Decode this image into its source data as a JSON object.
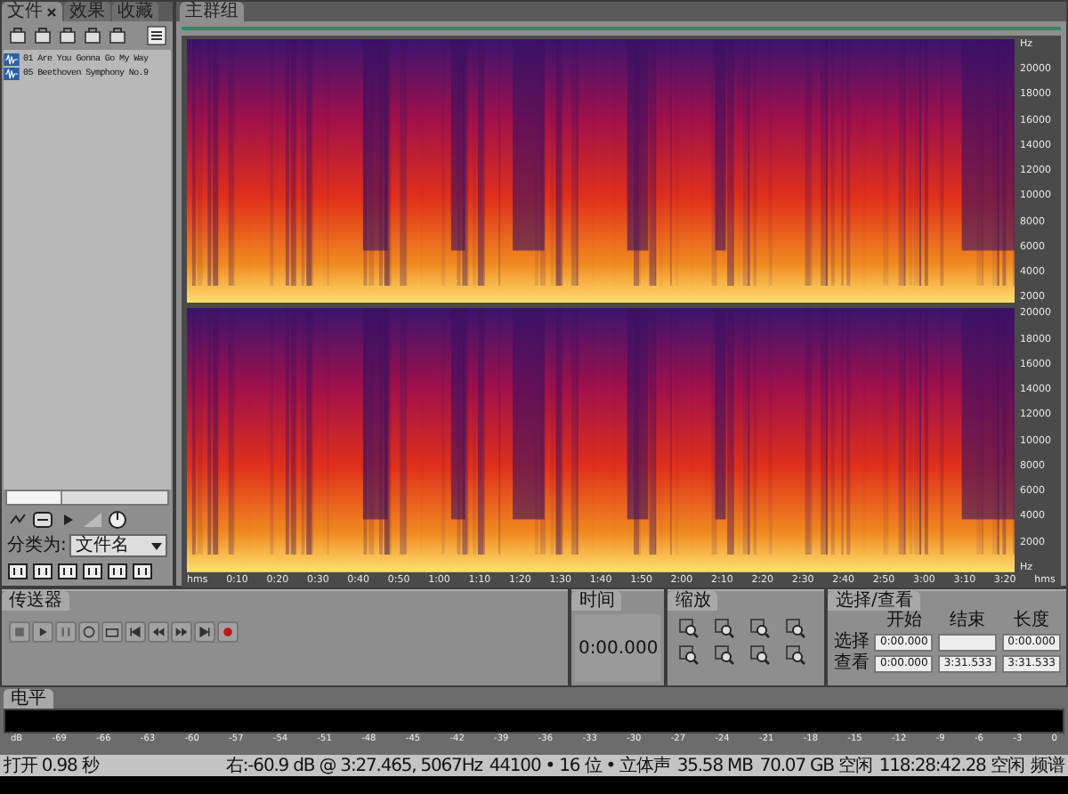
{
  "left_panel": {
    "tabs": [
      {
        "label": "文件",
        "selected": true
      },
      {
        "label": "效果",
        "selected": false
      },
      {
        "label": "收藏",
        "selected": false
      }
    ],
    "files": [
      "01 Are You Gonna Go My Way",
      "05 Beethoven Symphony No.9"
    ],
    "sort_label": "分类为:",
    "sort_value": "文件名"
  },
  "editor": {
    "tab": "主群组",
    "time_ticks": [
      "hms",
      "0:10",
      "0:20",
      "0:30",
      "0:40",
      "0:50",
      "1:00",
      "1:10",
      "1:20",
      "1:30",
      "1:40",
      "1:50",
      "2:00",
      "2:10",
      "2:20",
      "2:30",
      "2:40",
      "2:50",
      "3:00",
      "3:10",
      "3:20",
      "hms"
    ],
    "channels": [
      {
        "freq_ticks": [
          "Hz",
          "20000",
          "18000",
          "16000",
          "14000",
          "12000",
          "10000",
          "8000",
          "6000",
          "4000",
          "2000"
        ]
      },
      {
        "freq_ticks": [
          "20000",
          "18000",
          "16000",
          "14000",
          "12000",
          "10000",
          "8000",
          "6000",
          "4000",
          "2000",
          "Hz"
        ]
      }
    ]
  },
  "transport": {
    "title": "传送器"
  },
  "time_panel": {
    "title": "时间",
    "value": "0:00.000"
  },
  "zoom_panel": {
    "title": "缩放"
  },
  "selection_panel": {
    "title": "选择/查看",
    "columns": [
      "开始",
      "结束",
      "长度"
    ],
    "rows": [
      {
        "label": "选择",
        "start": "0:00.000",
        "length": "0:00.000"
      },
      {
        "label": "查看",
        "start": "0:00.000",
        "end": "3:31.533",
        "length": "3:31.533"
      }
    ]
  },
  "level_meter": {
    "title": "电平",
    "scale": [
      "dB",
      "-69",
      "-66",
      "-63",
      "-60",
      "-57",
      "-54",
      "-51",
      "-48",
      "-45",
      "-42",
      "-39",
      "-36",
      "-33",
      "-30",
      "-27",
      "-24",
      "-21",
      "-18",
      "-15",
      "-12",
      "-9",
      "-6",
      "-3",
      "0"
    ]
  },
  "status_bar": [
    "打开 0.98 秒",
    "右:-60.9 dB @ 3:27.465, 5067Hz",
    "44100 • 16 位 • 立体声",
    "35.58 MB",
    "70.07 GB 空闲",
    "118:28:42.28 空闲",
    "频谱"
  ]
}
